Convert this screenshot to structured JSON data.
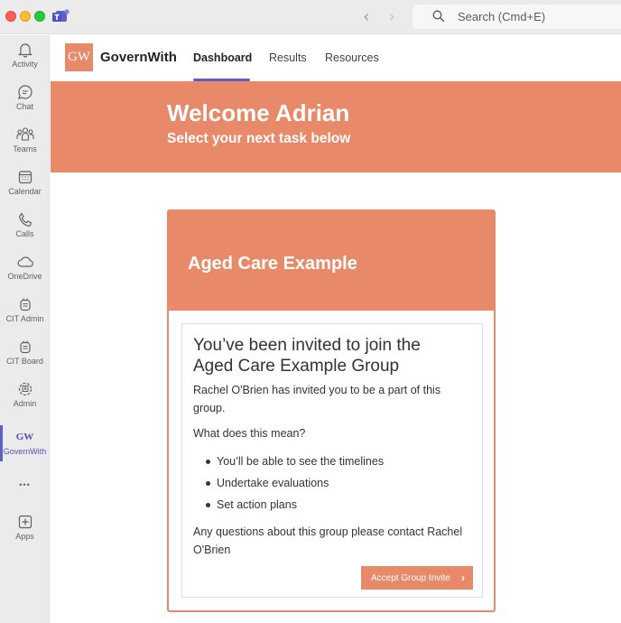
{
  "window": {
    "search_placeholder": "Search (Cmd+E)",
    "back_glyph": "‹",
    "forward_glyph": "›"
  },
  "rail": {
    "items": [
      {
        "label": "Activity",
        "icon": "bell-icon"
      },
      {
        "label": "Chat",
        "icon": "chat-icon"
      },
      {
        "label": "Teams",
        "icon": "teams-icon"
      },
      {
        "label": "Calendar",
        "icon": "calendar-icon"
      },
      {
        "label": "Calls",
        "icon": "phone-icon"
      },
      {
        "label": "OneDrive",
        "icon": "cloud-icon"
      },
      {
        "label": "CIT Admin",
        "icon": "app-icon"
      },
      {
        "label": "CIT Board",
        "icon": "app-icon"
      },
      {
        "label": "Admin",
        "icon": "admin-icon"
      },
      {
        "label": "GovernWith",
        "icon": "governwith-icon",
        "mini_logo": "GW",
        "active": true
      },
      {
        "label": "",
        "icon": "more-icon",
        "glyph": "•••"
      },
      {
        "label": "Apps",
        "icon": "add-apps-icon"
      }
    ]
  },
  "app": {
    "logo_text": "GW",
    "name": "GovernWith",
    "tabs": [
      {
        "label": "Dashboard",
        "active": true
      },
      {
        "label": "Results"
      },
      {
        "label": "Resources"
      }
    ]
  },
  "banner": {
    "title": "Welcome Adrian",
    "subtitle": "Select your next task below"
  },
  "card": {
    "title": "Aged Care Example",
    "invite_title": "You’ve been invited to join the Aged Care Example Group",
    "invited_by": "Rachel O'Brien has invited you to be a part of this group.",
    "question": "What does this mean?",
    "bullets": [
      "You’ll be able to see the timelines",
      "Undertake evaluations",
      "Set action plans"
    ],
    "contact": "Any questions about this group please contact Rachel O'Brien",
    "button_label": "Accept Group Invite",
    "button_chevron": "›"
  },
  "colors": {
    "accent": "#e8896a",
    "teams_purple": "#5b5fc7",
    "rail_bg": "#ebebeb"
  }
}
